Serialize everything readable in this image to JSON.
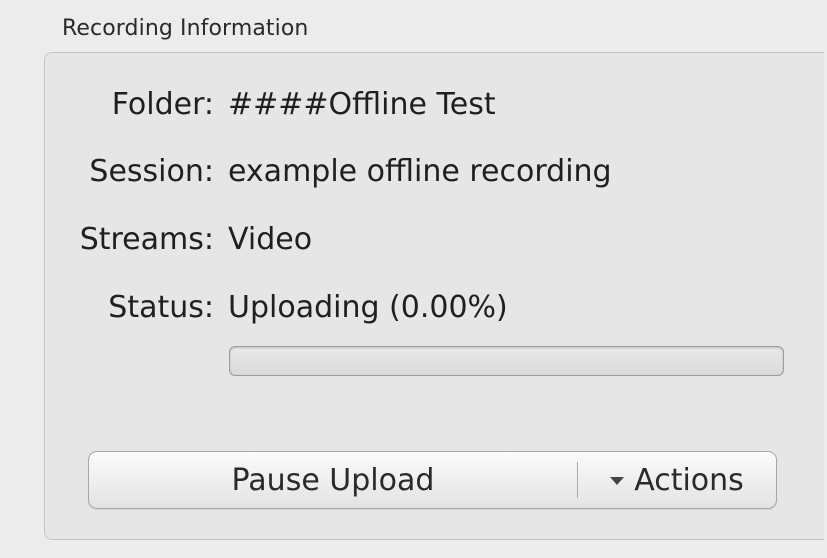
{
  "panel": {
    "title": "Recording Information"
  },
  "fields": {
    "folder_label": "Folder:",
    "folder_value": "####Offline Test",
    "session_label": "Session:",
    "session_value": "example offline recording",
    "streams_label": "Streams:",
    "streams_value": "Video",
    "status_label": "Status:",
    "status_value": "Uploading (0.00%)"
  },
  "progress": {
    "percent": 0.0
  },
  "buttons": {
    "pause_upload": "Pause Upload",
    "actions": "Actions",
    "actions_icon": "chevron-down-icon"
  },
  "colors": {
    "background": "#ececec",
    "progress_fill": "#3b7ad8"
  }
}
